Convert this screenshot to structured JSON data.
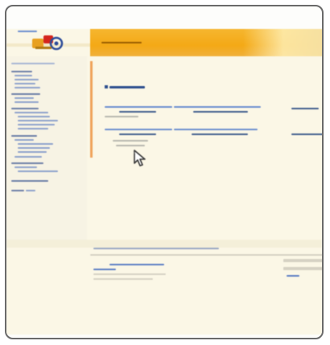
{
  "colors": {
    "frame_border": "#6a6a6a",
    "page_background": "#fbf7e6",
    "header_orange": "#f4a916",
    "sidebar_divider": "#f0a35a",
    "link_blue": "#6d8fd0",
    "heading_blue": "#2d4f8e"
  },
  "icons": {
    "logo": "site-logo",
    "pointer": "mouse-pointer-icon"
  }
}
